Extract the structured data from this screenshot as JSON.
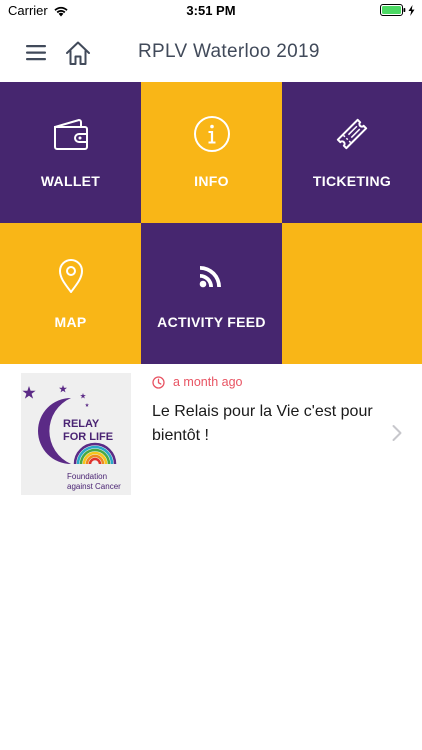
{
  "status_bar": {
    "carrier": "Carrier",
    "time": "3:51 PM"
  },
  "nav": {
    "title": "RPLV Waterloo 2019"
  },
  "colors": {
    "purple": "#46266f",
    "yellow": "#f9b617",
    "accent_red": "#e85463"
  },
  "tiles": [
    {
      "label": "WALLET",
      "icon": "wallet-icon",
      "color": "purple"
    },
    {
      "label": "INFO",
      "icon": "info-icon",
      "color": "yellow"
    },
    {
      "label": "TICKETING",
      "icon": "ticket-icon",
      "color": "purple"
    },
    {
      "label": "MAP",
      "icon": "map-pin-icon",
      "color": "yellow"
    },
    {
      "label": "ACTIVITY FEED",
      "icon": "rss-feed-icon",
      "color": "purple"
    },
    {
      "label": "",
      "icon": "",
      "color": "yellow"
    }
  ],
  "feed": {
    "items": [
      {
        "time": "a month ago",
        "headline": "Le Relais pour la Vie c'est pour bientôt !",
        "thumb": {
          "line1": "RELAY",
          "line2": "FOR LIFE",
          "line3": "Foundation",
          "line4": "against Cancer"
        }
      }
    ]
  }
}
